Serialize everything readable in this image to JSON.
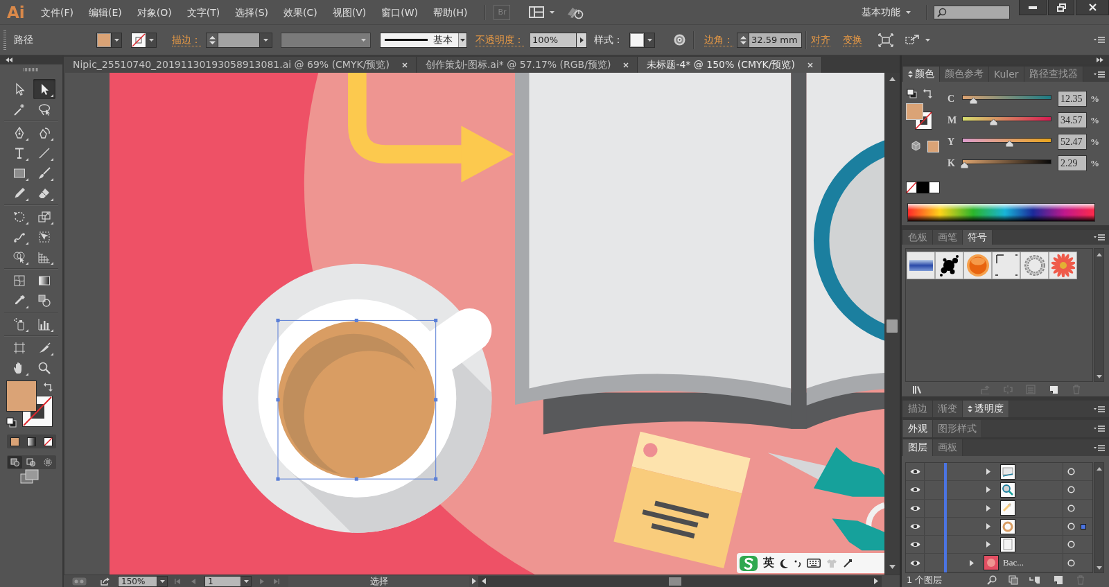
{
  "menu_bar": {
    "logo": "Ai",
    "items": [
      "文件(F)",
      "编辑(E)",
      "对象(O)",
      "文字(T)",
      "选择(S)",
      "效果(C)",
      "视图(V)",
      "窗口(W)",
      "帮助(H)"
    ],
    "bridge": "Br",
    "workspace": "基本功能"
  },
  "control_bar": {
    "object_type": "路径",
    "stroke_link": "描边：",
    "stroke_style": "基本",
    "opacity_link": "不透明度：",
    "opacity": "100%",
    "style_label": "样式：",
    "corner_link": "边角：",
    "corner_radius": "32.59 mm",
    "align_link": "对齐",
    "transform_link": "变换"
  },
  "document_tabs": [
    {
      "title": "Nipic_25510740_20191130193058913081.ai @ 69% (CMYK/预览)",
      "selected": false
    },
    {
      "title": "创作策划-图标.ai* @ 57.17% (RGB/预览)",
      "selected": false
    },
    {
      "title": "未标题-4* @ 150% (CMYK/预览)",
      "selected": true
    }
  ],
  "toolbar": {
    "tool_groups": [
      {
        "tools": [
          {
            "kind": "select",
            "selected": false,
            "flyout": false
          },
          {
            "kind": "direct",
            "selected": true,
            "flyout": true
          },
          {
            "kind": "wand",
            "selected": false,
            "flyout": false
          },
          {
            "kind": "lasso",
            "selected": false,
            "flyout": false
          }
        ]
      },
      {
        "tools": [
          {
            "kind": "pen",
            "selected": false,
            "flyout": true
          },
          {
            "kind": "curvature",
            "selected": false,
            "flyout": true
          },
          {
            "kind": "type",
            "selected": false,
            "flyout": true
          },
          {
            "kind": "line",
            "selected": false,
            "flyout": true
          },
          {
            "kind": "rectangle",
            "selected": false,
            "flyout": true
          },
          {
            "kind": "brush",
            "selected": false,
            "flyout": true
          },
          {
            "kind": "pencil",
            "selected": false,
            "flyout": true
          },
          {
            "kind": "eraser",
            "selected": false,
            "flyout": true
          }
        ]
      },
      {
        "tools": [
          {
            "kind": "rotate",
            "selected": false,
            "flyout": true
          },
          {
            "kind": "scale",
            "selected": false,
            "flyout": true
          },
          {
            "kind": "warp",
            "selected": false,
            "flyout": true
          },
          {
            "kind": "freetransform",
            "selected": false,
            "flyout": false
          },
          {
            "kind": "shapebuilder",
            "selected": false,
            "flyout": true
          },
          {
            "kind": "perspective",
            "selected": false,
            "flyout": true
          }
        ]
      },
      {
        "tools": [
          {
            "kind": "mesh",
            "selected": false,
            "flyout": false
          },
          {
            "kind": "gradient",
            "selected": false,
            "flyout": false
          },
          {
            "kind": "eyedropper",
            "selected": false,
            "flyout": true
          },
          {
            "kind": "blend",
            "selected": false,
            "flyout": false
          }
        ]
      },
      {
        "tools": [
          {
            "kind": "sprayer",
            "selected": false,
            "flyout": true
          },
          {
            "kind": "graph",
            "selected": false,
            "flyout": true
          }
        ]
      },
      {
        "tools": [
          {
            "kind": "artboard",
            "selected": false,
            "flyout": false
          },
          {
            "kind": "slice",
            "selected": false,
            "flyout": true
          },
          {
            "kind": "hand",
            "selected": false,
            "flyout": true
          },
          {
            "kind": "zoom",
            "selected": false,
            "flyout": false
          }
        ]
      }
    ],
    "color_modes": [
      {
        "kind": "color"
      },
      {
        "kind": "gradient"
      },
      {
        "kind": "none"
      }
    ],
    "drawing_modes": [
      {
        "kind": "normal",
        "selected": true
      },
      {
        "kind": "behind",
        "selected": false
      },
      {
        "kind": "inside",
        "selected": false
      }
    ]
  },
  "ime_toolbar": {
    "language": "英"
  },
  "status_bar": {
    "zoom": "150%",
    "artboard": "1",
    "tool_status": "选择"
  },
  "color_panel": {
    "tabs": [
      {
        "label": "颜色",
        "selected": true,
        "options": true
      },
      {
        "label": "颜色参考",
        "selected": false,
        "options": false
      },
      {
        "label": "Kuler",
        "selected": false,
        "options": false
      },
      {
        "label": "路径查找器",
        "selected": false,
        "options": false
      }
    ],
    "channels": [
      {
        "kind": "cyan",
        "label": "C",
        "level": 0.1235,
        "value": "12.35",
        "unit": "%"
      },
      {
        "kind": "magenta",
        "label": "M",
        "level": 0.3457,
        "value": "34.57",
        "unit": "%"
      },
      {
        "kind": "yellow",
        "label": "Y",
        "level": 0.5247,
        "value": "52.47",
        "unit": "%"
      },
      {
        "kind": "black",
        "label": "K",
        "level": 0.0229,
        "value": "2.29",
        "unit": "%"
      }
    ]
  },
  "symbols_panel": {
    "tabs": [
      {
        "label": "色板",
        "selected": false,
        "options": false
      },
      {
        "label": "画笔",
        "selected": false,
        "options": false
      },
      {
        "label": "符号",
        "selected": true,
        "options": false
      }
    ],
    "symbols": [
      {
        "kind": "banner"
      },
      {
        "kind": "splat"
      },
      {
        "kind": "button"
      },
      {
        "kind": "marker"
      },
      {
        "kind": "wreath"
      },
      {
        "kind": "flower"
      }
    ],
    "actions": [
      {
        "kind": "place",
        "disabled": true
      },
      {
        "kind": "unlink",
        "disabled": true
      },
      {
        "kind": "options",
        "disabled": true
      },
      {
        "kind": "new",
        "disabled": false
      },
      {
        "kind": "delete",
        "disabled": true
      }
    ]
  },
  "stroke_tabs": [
    {
      "label": "描边",
      "selected": false,
      "options": false
    },
    {
      "label": "渐变",
      "selected": false,
      "options": false
    },
    {
      "label": "透明度",
      "selected": true,
      "options": true
    }
  ],
  "appearance_tabs": [
    {
      "label": "外观",
      "selected": true,
      "options": false
    },
    {
      "label": "图形样式",
      "selected": false,
      "options": false
    }
  ],
  "layers_panel": {
    "tabs": [
      {
        "label": "图层",
        "selected": true,
        "options": false
      },
      {
        "label": "画板",
        "selected": false,
        "options": false
      }
    ],
    "rows": [
      {
        "kind": "group",
        "thumbnail": {
          "kind": "book"
        },
        "visible": true,
        "selected": false
      },
      {
        "kind": "group",
        "thumbnail": {
          "kind": "magnifier"
        },
        "visible": true,
        "selected": false
      },
      {
        "kind": "group",
        "thumbnail": {
          "kind": "note"
        },
        "visible": true,
        "selected": false
      },
      {
        "kind": "group",
        "thumbnail": {
          "kind": "cup"
        },
        "visible": true,
        "selected": true
      },
      {
        "kind": "group",
        "thumbnail": {
          "kind": "page"
        },
        "visible": true,
        "selected": false
      },
      {
        "kind": "sublayer",
        "thumbnail": {
          "kind": "background"
        },
        "name": "Bac...",
        "visible": true,
        "selected": false
      }
    ],
    "footer": "1 个图层"
  }
}
